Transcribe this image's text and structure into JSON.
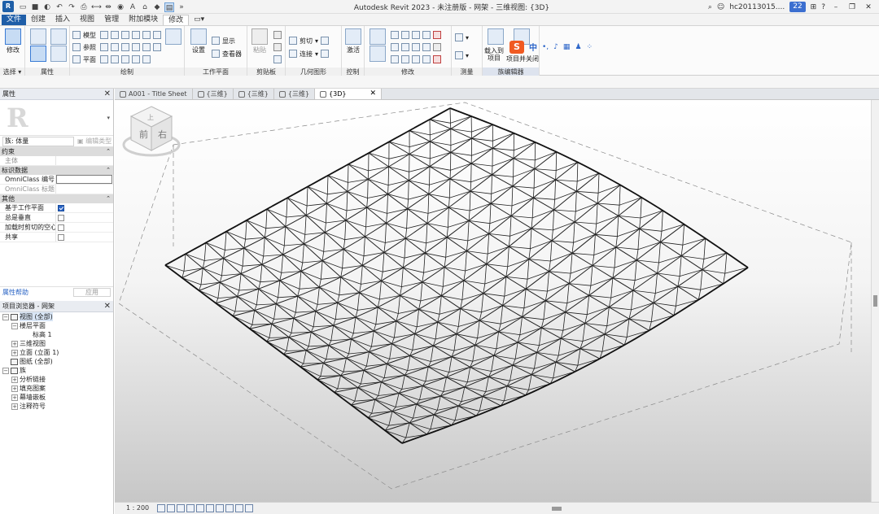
{
  "window": {
    "title": "Autodesk Revit 2023 - 未注册版 - 网架 - 三维视图: {3D}",
    "app_icon_label": "R",
    "user": "hc20113015....",
    "notifications": "22"
  },
  "ribbon": {
    "tabs": [
      "文件",
      "创建",
      "插入",
      "视图",
      "管理",
      "附加模块",
      "修改"
    ],
    "active_tab": "修改",
    "panels": {
      "select": {
        "label": "选择",
        "button": "修改"
      },
      "properties": {
        "label": "属性"
      },
      "draw": {
        "label": "绘制",
        "items": [
          "模型",
          "参照",
          "平面"
        ]
      },
      "workplane": {
        "label": "工作平面",
        "set": "设置",
        "show": "显示",
        "viewer": "查看器"
      },
      "clipboard": {
        "label": "剪贴板",
        "paste": "粘贴"
      },
      "geometry": {
        "label": "几何图形",
        "cut": "剪切",
        "join": "连接"
      },
      "control": {
        "label": "控制",
        "activate": "激活"
      },
      "modify": {
        "label": "修改"
      },
      "measure": {
        "label": "测量"
      },
      "family_editor": {
        "label": "族编辑器",
        "load_into_project": "载入到\n项目",
        "load_and_close": "项目并关闭"
      }
    }
  },
  "properties": {
    "title": "属性",
    "family_label": "族: 体量",
    "edit_type": "编辑类型",
    "sections": {
      "constraints": "约束",
      "identity": "标识数据",
      "other": "其他"
    },
    "rows": {
      "host": "主体",
      "omniclass_number": "OmniClass 编号",
      "omniclass_title": "OmniClass 标题",
      "workplane_based": "基于工作平面",
      "always_vertical": "总是垂直",
      "cut_voids": "加载时剪切的空心",
      "shared": "共享"
    },
    "help": "属性帮助",
    "apply": "应用"
  },
  "browser": {
    "title": "项目浏览器 - 网架",
    "nodes": {
      "views_all": "视图 (全部)",
      "floor_plans": "楼层平面",
      "level1": "标高 1",
      "views_3d": "三维视图",
      "elevations": "立面 (立面 1)",
      "sheets_all": "图纸 (全部)",
      "families": "族",
      "analytical_links": "分析链接",
      "fill_patterns": "填充图案",
      "curtain_panels": "幕墙嵌板",
      "annotation_symbols": "注释符号"
    }
  },
  "view_tabs": [
    "A001 - Title Sheet",
    "{三维}",
    "{三维}",
    "{三维}",
    "{3D}"
  ],
  "active_view_tab": "{3D}",
  "viewcube": {
    "left_face": "前",
    "right_face": "右",
    "top_face": "上"
  },
  "statusbar": {
    "scale": "1 : 200"
  }
}
